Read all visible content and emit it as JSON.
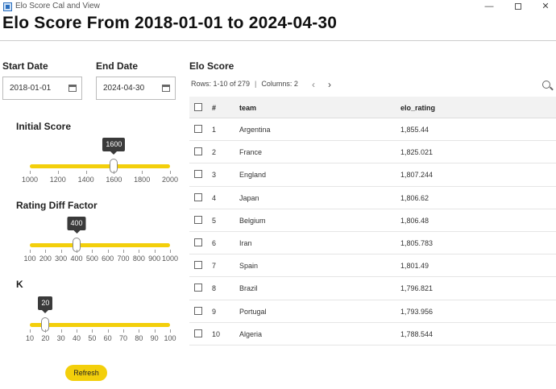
{
  "window": {
    "title": "Elo Score Cal and View",
    "min_glyph": "—",
    "close_glyph": "✕",
    "icon": "app-window-icon"
  },
  "page": {
    "title": "Elo Score From 2018-01-01 to 2024-04-30"
  },
  "dates": {
    "start": {
      "label": "Start Date",
      "value": "2018-01-01",
      "icon": "calendar-icon"
    },
    "end": {
      "label": "End Date",
      "value": "2024-04-30",
      "icon": "calendar-icon"
    }
  },
  "sliders": {
    "initial_score": {
      "label": "Initial Score",
      "value": "1600",
      "min": 1000,
      "max": 2000,
      "ticks": [
        "1000",
        "1200",
        "1400",
        "1600",
        "1800",
        "2000"
      ]
    },
    "rating_diff": {
      "label": "Rating Diff Factor",
      "value": "400",
      "min": 100,
      "max": 1000,
      "ticks": [
        "100",
        "200",
        "300",
        "400",
        "500",
        "600",
        "700",
        "800",
        "900",
        "1000"
      ]
    },
    "k": {
      "label": "K",
      "value": "20",
      "min": 10,
      "max": 100,
      "ticks": [
        "10",
        "20",
        "30",
        "40",
        "50",
        "60",
        "70",
        "80",
        "90",
        "100"
      ]
    }
  },
  "refresh_label": "Refresh",
  "table": {
    "title": "Elo Score",
    "rows_info": "Rows: 1-10 of 279",
    "columns_info": "Columns: 2",
    "prev_glyph": "‹",
    "next_glyph": "›",
    "headers": [
      "#",
      "team",
      "elo_rating"
    ],
    "rows": [
      [
        "1",
        "Argentina",
        "1,855.44"
      ],
      [
        "2",
        "France",
        "1,825.021"
      ],
      [
        "3",
        "England",
        "1,807.244"
      ],
      [
        "4",
        "Japan",
        "1,806.62"
      ],
      [
        "5",
        "Belgium",
        "1,806.48"
      ],
      [
        "6",
        "Iran",
        "1,805.783"
      ],
      [
        "7",
        "Spain",
        "1,801.49"
      ],
      [
        "8",
        "Brazil",
        "1,796.821"
      ],
      [
        "9",
        "Portugal",
        "1,793.956"
      ],
      [
        "10",
        "Algeria",
        "1,788.544"
      ]
    ]
  },
  "colors": {
    "accent": "#f3cf0b",
    "bubble": "#3a3a3a"
  }
}
